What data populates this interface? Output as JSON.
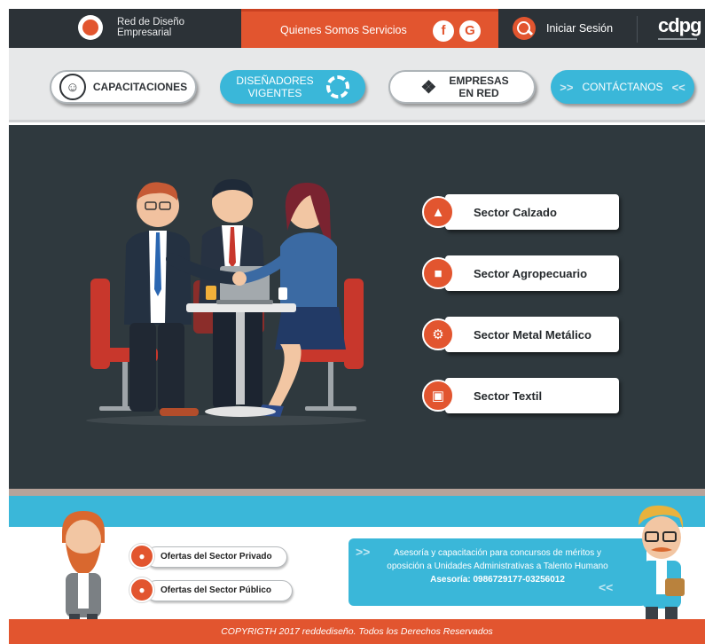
{
  "header": {
    "logo_line1": "Red de Diseño",
    "logo_line2": "Empresarial",
    "nav": {
      "quienes_somos": "Quienes Somos",
      "servicios": "Servicios"
    },
    "social": {
      "facebook_glyph": "f",
      "google_glyph": "G"
    },
    "login_label": "Iniciar Sesión",
    "partner_logo_text": "cdpg"
  },
  "tabs": {
    "capacitaciones": "CAPACITACIONES",
    "disenadores_line1": "DISEÑADORES",
    "disenadores_line2": "VIGENTES",
    "empresas_line1": "EMPRESAS",
    "empresas_line2": "EN RED",
    "contactanos": "CONTÁCTANOS",
    "chevrons_left": ">>",
    "chevrons_right": "<<"
  },
  "sectors": [
    {
      "label": "Sector Calzado",
      "icon": "shoe-icon"
    },
    {
      "label": "Sector Agropecuario",
      "icon": "cow-icon"
    },
    {
      "label": "Sector Metal Metálico",
      "icon": "gear-icon"
    },
    {
      "label": "Sector Textil",
      "icon": "sewing-machine-icon"
    }
  ],
  "footer": {
    "oferta_privado": "Ofertas del Sector Privado",
    "oferta_publico": "Ofertas del Sector Público",
    "asesoria_line1": "Asesoría y capacitación para concursos de méritos y",
    "asesoria_line2": "oposición a Unidades Administrativas a Talento Humano",
    "asesoria_line3": "Asesoría: 0986729177-03256012",
    "copyright": "COPYRIGTH 2017 reddediseño. Todos los Derechos Reservados"
  },
  "colors": {
    "brand_orange": "#e2552f",
    "accent_blue": "#3ab7d9",
    "dark_panel": "#2f393e",
    "topbar": "#2c3237"
  }
}
